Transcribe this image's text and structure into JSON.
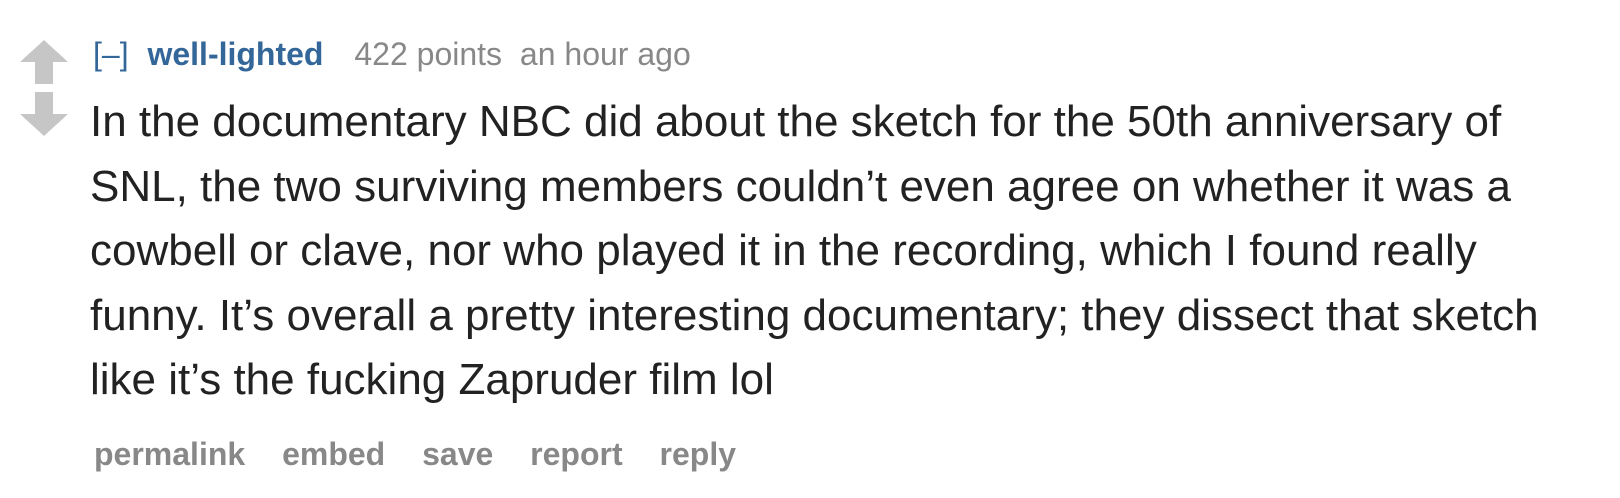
{
  "comment": {
    "expand_label": "[–]",
    "author": "well-lighted",
    "score": "422 points",
    "time": "an hour ago",
    "body": "In the documentary NBC did about the sketch for the 50th anniversary of SNL, the two surviving members couldn’t even agree on whether it was a cowbell or clave, nor who played it in the recording, which I found really funny. It’s overall a pretty interesting documentary; they dissect that sketch like it’s the fucking Zapruder film lol",
    "vote_icons": {
      "up": "upvote-arrow-icon",
      "down": "downvote-arrow-icon"
    },
    "buttons": {
      "permalink": "permalink",
      "embed": "embed",
      "save": "save",
      "report": "report",
      "reply": "reply"
    }
  },
  "colors": {
    "link": "#336699",
    "meta": "#888888",
    "body_text": "#222222",
    "arrow": "#c6c6c6"
  }
}
